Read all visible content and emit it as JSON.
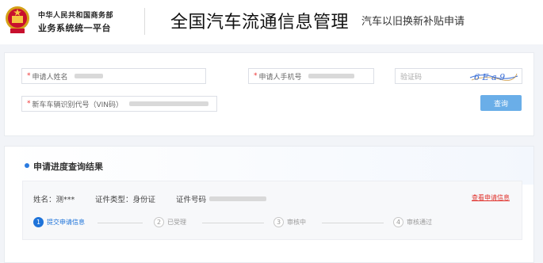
{
  "header": {
    "ministry": "中华人民共和国商务部",
    "platform": "业务系统统一平台",
    "title": "全国汽车流通信息管理",
    "subtitle": "汽车以旧换新补贴申请"
  },
  "form": {
    "applicant_name_label": "申请人姓名",
    "applicant_phone_label": "申请人手机号",
    "captcha_placeholder": "验证码",
    "captcha_text": "6 E a 9",
    "vin_label": "新车车辆识别代号（VIN码）",
    "required_mark": "*",
    "query_button": "查询"
  },
  "result": {
    "title": "申请进度查询结果",
    "name": "姓名：测***",
    "id_type": "证件类型：身份证",
    "id_number_label": "证件号码",
    "detail_link": "查看申请信息",
    "steps": [
      {
        "num": "1",
        "label": "提交申请信息",
        "active": true
      },
      {
        "num": "2",
        "label": "已受理",
        "active": false
      },
      {
        "num": "3",
        "label": "审核中",
        "active": false
      },
      {
        "num": "4",
        "label": "审核通过",
        "active": false
      }
    ]
  },
  "colors": {
    "accent": "#1e73d9",
    "button": "#6aaee8",
    "link": "#e0322c",
    "required": "#ee3333"
  }
}
